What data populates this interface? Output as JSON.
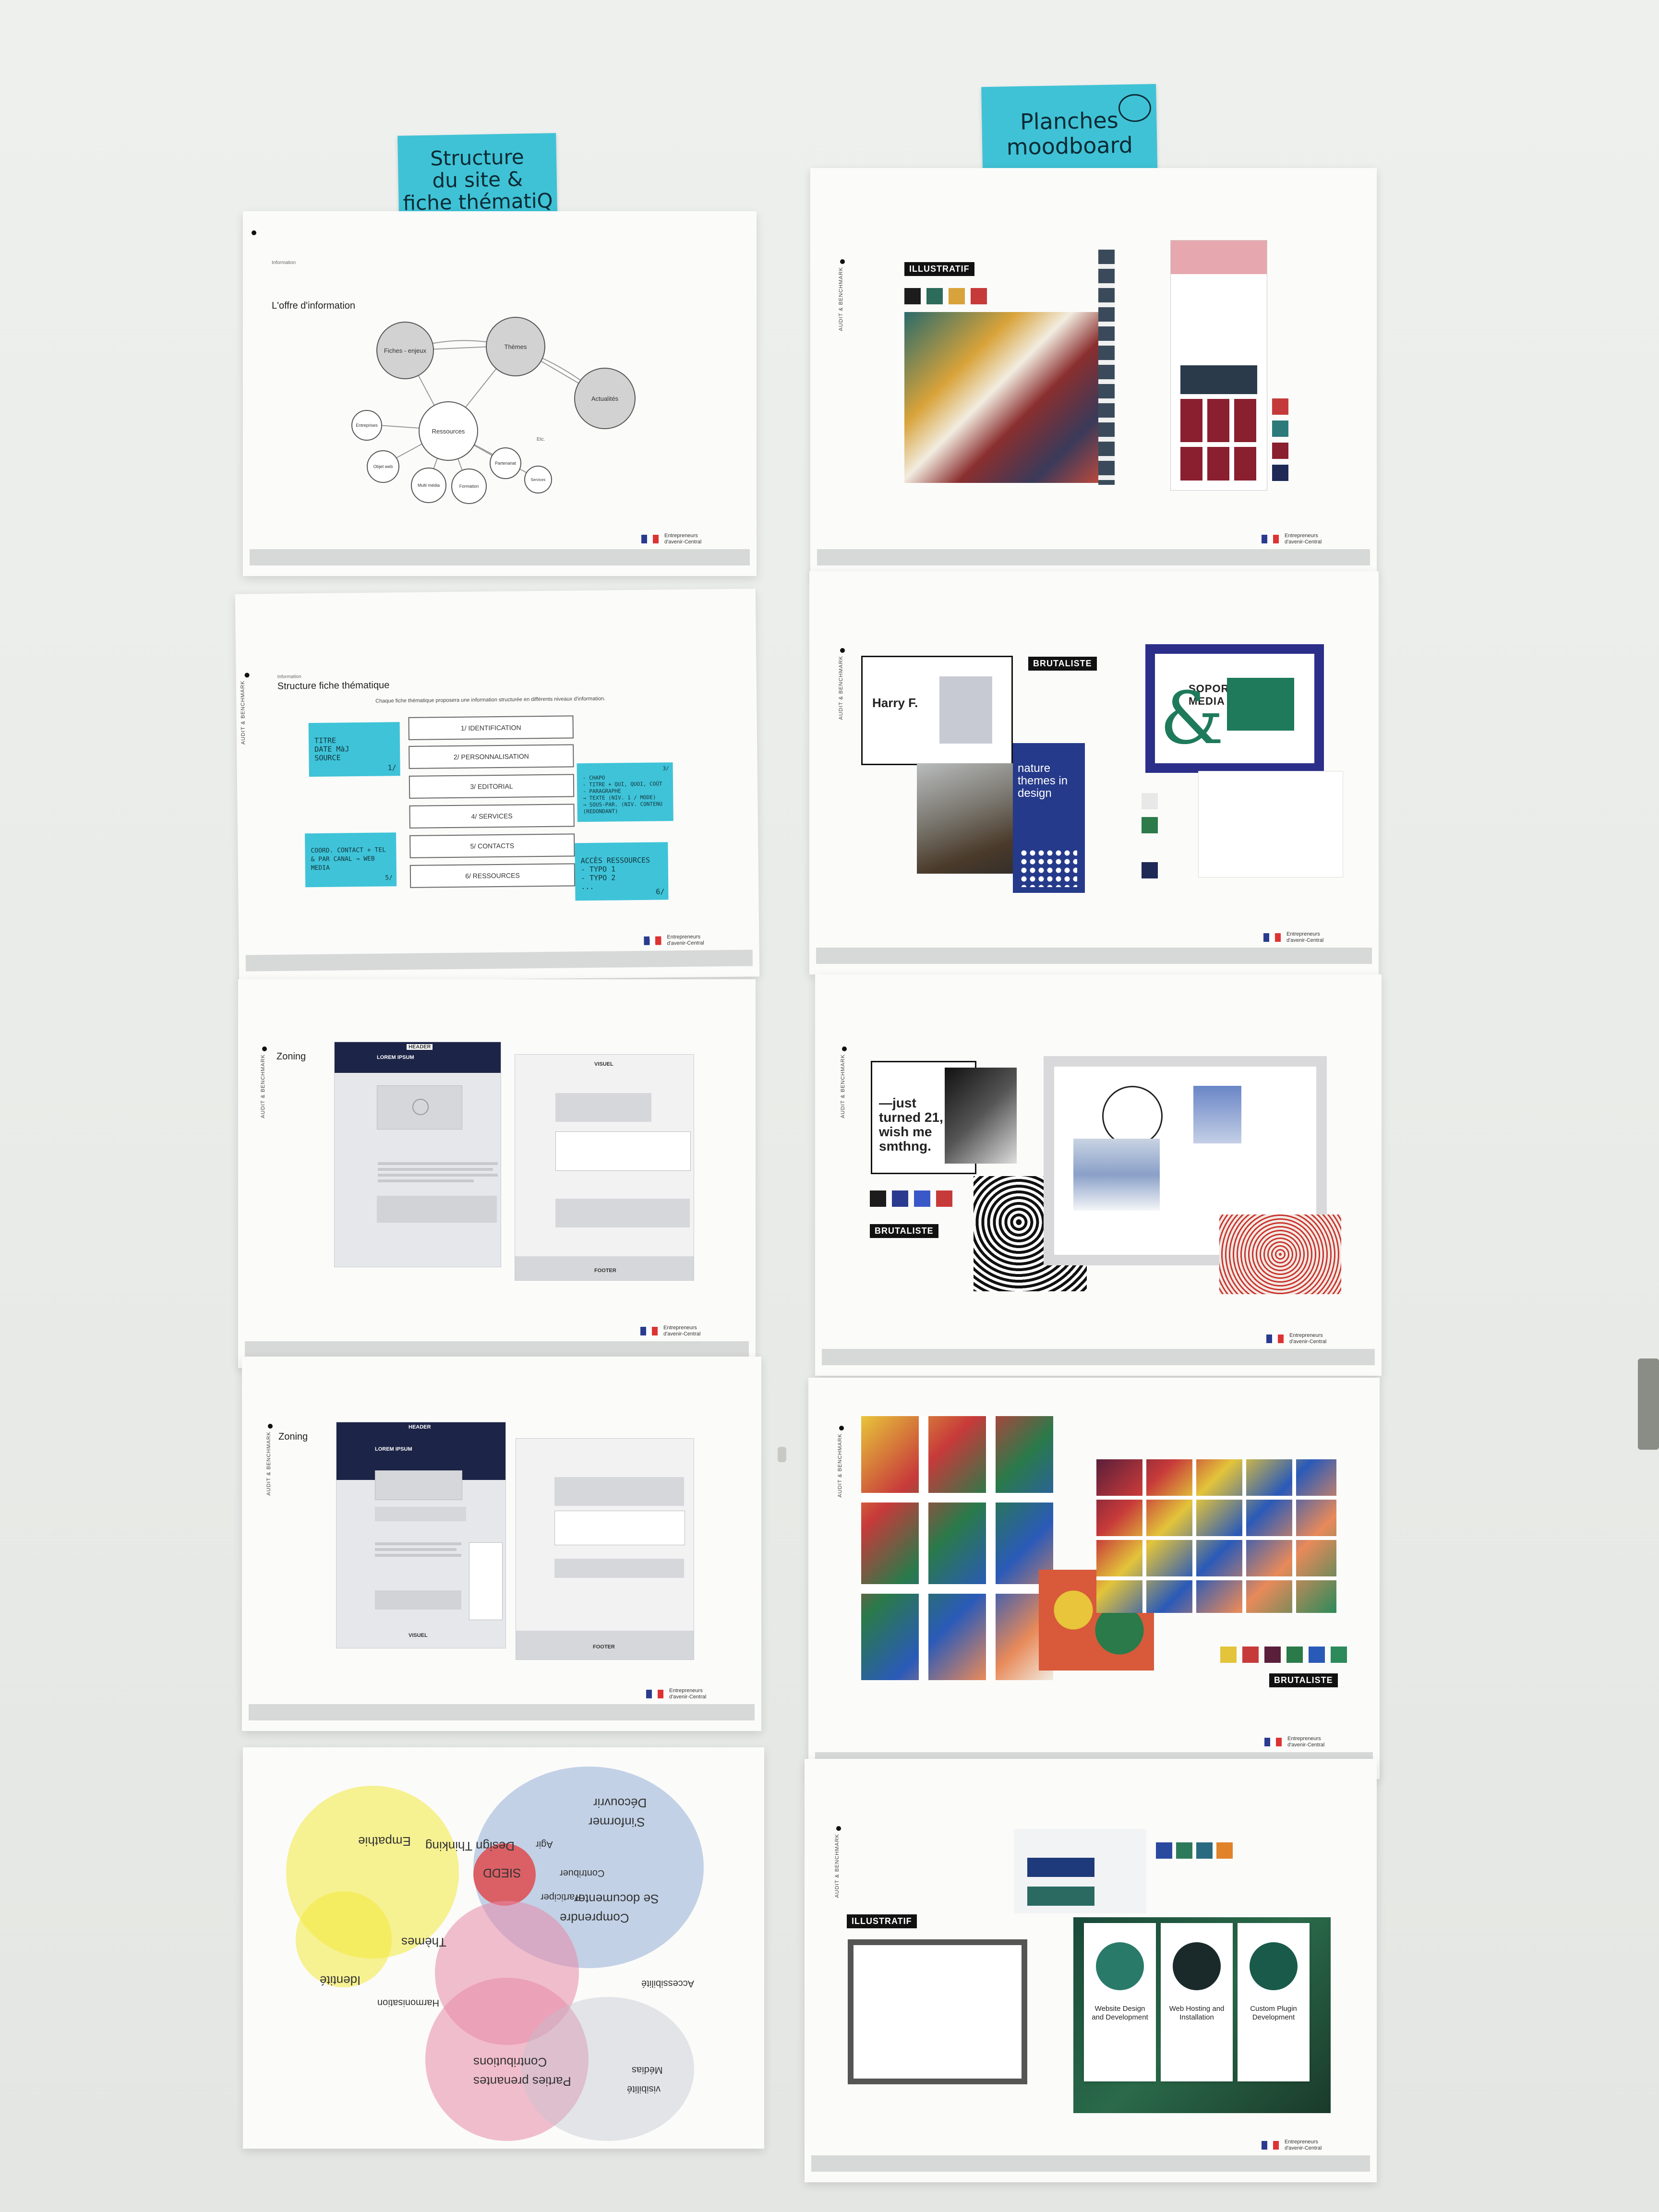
{
  "sticky_notes": {
    "left": "Structure\ndu site &\nfiche thématiQ",
    "right": "Planches\nmoodboard"
  },
  "sheet1": {
    "kicker": "Information",
    "title": "L'offre d'information",
    "nodes": [
      "Fiches - enjeux",
      "Thèmes",
      "Ressources",
      "Actualités",
      "Entreprises",
      "Objet web",
      "Multi média",
      "Formation",
      "Partenariat",
      "Services",
      "Etc."
    ],
    "theme_sub": "11 + 10",
    "res_sub": "ZA"
  },
  "sheet2": {
    "kicker": "Information",
    "title": "Structure fiche thématique",
    "intro": "Chaque fiche thématique proposera une information structurée en différents niveaux d'information.",
    "sections": [
      "1/ IDENTIFICATION",
      "2/ PERSONNALISATION",
      "3/ EDITORIAL",
      "4/ SERVICES",
      "5/ CONTACTS",
      "6/ RESSOURCES"
    ],
    "note_titre": "TITRE\nDATE MàJ\nSOURCE",
    "note_titre_num": "1/",
    "note_coord": "COORD. CONTACT + TEL\n& PAR CANAL → WEB\nMEDIA",
    "note_coord_num": "5/",
    "note_chapo": "- CHAPO\n- TITRE + QUI, QUOI, COÛT\n- PARAGRAPHE\n→ TEXTE (NIV. 1 / MODE)\n→ SOUS-PAR. (NIV. CONTENU\n  (REDONDANT)",
    "note_chapo_num": "3/",
    "note_acces": "ACCÈS RESSOURCES\n- TYPO 1\n- TYPO 2\n...",
    "note_acces_num": "6/"
  },
  "sheet3": {
    "title": "Zoning",
    "header": "HEADER",
    "lorem": "LOREM IPSUM",
    "visuel": "VISUEL",
    "footer": "FOOTER"
  },
  "sheet4": {
    "title": "Zoning",
    "header": "HEADER",
    "lorem": "LOREM IPSUM",
    "visuel": "VISUEL",
    "footer": "FOOTER"
  },
  "sheet5": {
    "words": [
      "Découvrir",
      "S'informer",
      "Agir",
      "Contribuer",
      "SIEDD",
      "Comprendre",
      "Se documenter",
      "Empathie",
      "Design Thinking",
      "Thèmes",
      "Identité",
      "Harmonisation",
      "Parties prenantes",
      "Contributions",
      "Participer",
      "Médias",
      "visibilité",
      "Accessibilité"
    ]
  },
  "moodboard": {
    "sheet6_tag": "ILLUSTRATIF",
    "sheet6_colors": [
      "#1c1c1c",
      "#2d6b5a",
      "#d8a33a",
      "#c73a3a"
    ],
    "sheet6_colors_right": [
      "#c43a3a",
      "#2d7a7a",
      "#8a1f2f",
      "#1e2a55"
    ],
    "sheet7_tag": "BRUTALISTE",
    "sheet7_poster": "nature themes in design",
    "sheet7_name": "Harry F.",
    "sheet7_media": "SOPORTE MEDIA",
    "sheet7_colors": [
      "#e8e8e8",
      "#2d7a4a",
      "#1e2a55"
    ],
    "sheet8_tag": "BRUTALISTE",
    "sheet8_quote": "—just turned 21, wish me smthng.",
    "sheet8_colors": [
      "#1c1c1c",
      "#2a3b8f",
      "#3b58c8",
      "#c73a3a"
    ],
    "sheet9_tag": "BRUTALISTE",
    "sheet9_colors": [
      "#e3c43a",
      "#c73a3a",
      "#5a1f3a",
      "#2a7a4a",
      "#2a5ab8",
      "#2d8a5a"
    ],
    "sheet10_tag": "ILLUSTRATIF",
    "sheet10_colors": [
      "#2a4aa0",
      "#2d7a5a",
      "#2a6a80",
      "#e0832a"
    ],
    "sheet10_cards": [
      "Website Design and Development",
      "Web Hosting and Installation",
      "Custom Plugin Development"
    ]
  },
  "footer_logo": {
    "line1": "Entrepreneurs",
    "line2": "d'avenir-Central"
  },
  "side_label": "AUDIT & BENCHMARK"
}
